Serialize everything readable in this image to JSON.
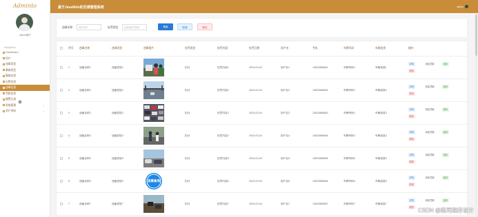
{
  "sidebar": {
    "logo": "Adminto",
    "username": "admin用户",
    "nav_header": "Navigation",
    "items": [
      {
        "label": "Dashboard",
        "icon": "dashboard-icon"
      },
      {
        "label": "用户",
        "icon": "user-icon"
      },
      {
        "label": "违章类型",
        "icon": "list-icon"
      },
      {
        "label": "事故类型",
        "icon": "list-icon"
      },
      {
        "label": "事故信息",
        "icon": "file-icon"
      },
      {
        "label": "出警信息",
        "icon": "car-icon"
      },
      {
        "label": "违章信息",
        "icon": "warning-icon"
      },
      {
        "label": "罚款信息",
        "icon": "money-icon"
      },
      {
        "label": "缴费记录",
        "icon": "receipt-icon"
      },
      {
        "label": "系统管理",
        "icon": "gear-icon"
      },
      {
        "label": "用户资料",
        "icon": "profile-icon"
      }
    ]
  },
  "header": {
    "title": "基于JavaWeb的交通管理系统",
    "user": "admin"
  },
  "search": {
    "name_label": "违章名称",
    "name_placeholder": "违章名称",
    "type_label": "处罚类型",
    "type_placeholder": "请选择处罚类型",
    "search_button": "搜索",
    "add_button": "新增",
    "delete_button": "删除"
  },
  "table": {
    "columns": [
      "序号",
      "违章名称",
      "违章类型",
      "违章图片",
      "处罚类型",
      "处罚内容",
      "处罚日期",
      "用户名",
      "手机",
      "车牌号码",
      "车辆信息",
      "操作"
    ],
    "rows": [
      {
        "index": "1",
        "name": "违章名称1",
        "type": "违章类型1",
        "penalty_type": "扣分",
        "content": "处罚内容1",
        "date": "2024-03-04",
        "user": "用户名1",
        "phone": "13823888881",
        "plate": "车牌号码1",
        "vehicle": "车辆信息1",
        "thumb": "car-people"
      },
      {
        "index": "2",
        "name": "违章名称2",
        "type": "违章类型2",
        "penalty_type": "扣分",
        "content": "处罚内容2",
        "date": "2024-03-04",
        "user": "用户名2",
        "phone": "13823888882",
        "plate": "车牌号码2",
        "vehicle": "车辆信息2",
        "thumb": "bridge"
      },
      {
        "index": "3",
        "name": "违章名称3",
        "type": "违章类型3",
        "penalty_type": "扣分",
        "content": "处罚内容3",
        "date": "2024-03-04",
        "user": "用户名3",
        "phone": "13823888883",
        "plate": "车牌号码3",
        "vehicle": "车辆信息3",
        "thumb": "traffic"
      },
      {
        "index": "4",
        "name": "违章名称4",
        "type": "违章类型4",
        "penalty_type": "扣分",
        "content": "处罚内容4",
        "date": "2024-03-04",
        "user": "用户名4",
        "phone": "13823888884",
        "plate": "车牌号码4",
        "vehicle": "车辆信息4",
        "thumb": "street"
      },
      {
        "index": "5",
        "name": "违章名称5",
        "type": "违章类型5",
        "penalty_type": "扣分",
        "content": "处罚内容5",
        "date": "2024-03-04",
        "user": "用户名5",
        "phone": "13823888885",
        "plate": "车牌号码5",
        "vehicle": "车辆信息5",
        "thumb": "parking"
      },
      {
        "index": "6",
        "name": "违章名称6",
        "type": "违章类型6",
        "penalty_type": "扣分",
        "content": "处罚内容6",
        "date": "2024-03-04",
        "user": "用户名6",
        "phone": "13823888886",
        "plate": "车牌号码6",
        "vehicle": "车辆信息6",
        "thumb": "query-logo",
        "thumb_text": "违章查询"
      },
      {
        "index": "7",
        "name": "违章名称7",
        "type": "违章类型7",
        "penalty_type": "扣分",
        "content": "处罚内容7",
        "date": "2024-03-04",
        "user": "用户名7",
        "phone": "13823888887",
        "plate": "车牌号码7",
        "vehicle": "车辆信息7",
        "thumb": "road"
      }
    ],
    "actions": {
      "detail": "详情",
      "delete": "删除",
      "pay": "添加罚款",
      "fine": "缴费"
    }
  },
  "watermark": "CSDN @路司程序设计",
  "colors": {
    "accent": "#c98d3a",
    "primary": "#2a7bd6",
    "danger": "#e06060",
    "success": "#4caf50"
  }
}
